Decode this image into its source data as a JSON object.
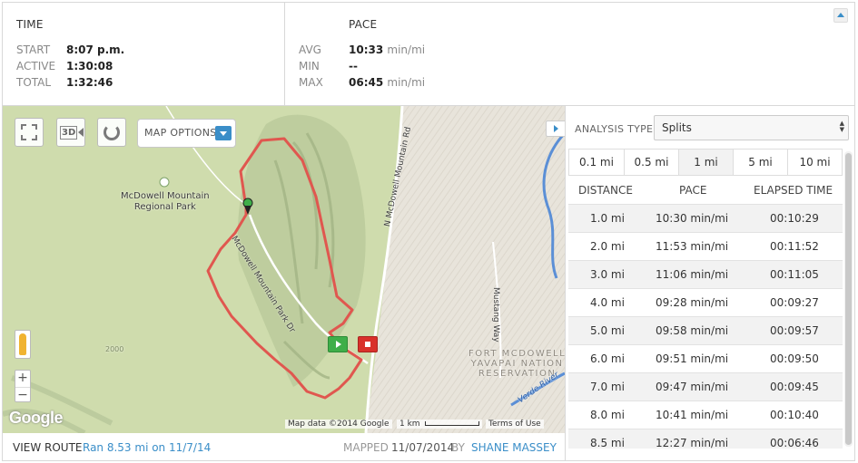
{
  "summary": {
    "time": {
      "title": "TIME",
      "rows": [
        {
          "label": "START",
          "value": "8:07 p.m.",
          "unit": ""
        },
        {
          "label": "ACTIVE",
          "value": "1:30:08",
          "unit": ""
        },
        {
          "label": "TOTAL",
          "value": "1:32:46",
          "unit": ""
        }
      ]
    },
    "pace": {
      "title": "PACE",
      "rows": [
        {
          "label": "AVG",
          "value": "10:33",
          "unit": "min/mi"
        },
        {
          "label": "MIN",
          "value": "--",
          "unit": ""
        },
        {
          "label": "MAX",
          "value": "06:45",
          "unit": "min/mi"
        }
      ]
    }
  },
  "map": {
    "options_label": "MAP OPTIONS",
    "btn_3d": "3D",
    "zoom_in": "+",
    "zoom_out": "−",
    "labels": {
      "park": "McDowell Mountain\nRegional Park",
      "park_dr": "McDowell Mountain Park Dr",
      "n_mcdowell": "N McDowell Mountain Rd",
      "mustang": "Mustang Way",
      "fort_mcdowell": "FORT MCDOWELL\nYAVAPAI NATION\nRESERVATION",
      "verde": "Verde River",
      "contour_2000": "2000"
    },
    "attribution": "Map data ©2014 Google",
    "scale": "1 km",
    "terms": "Terms of Use",
    "google": "Google"
  },
  "footer": {
    "view_route": "VIEW ROUTE",
    "ran": "Ran 8.53 mi on 11/7/14",
    "mapped_label": "MAPPED",
    "mapped_date": "11/07/2014",
    "by": "BY",
    "owner": "SHANE MASSEY"
  },
  "analysis": {
    "type_label": "ANALYSIS TYPE:",
    "type_value": "Splits",
    "tabs": [
      "0.1 mi",
      "0.5 mi",
      "1 mi",
      "5 mi",
      "10 mi"
    ],
    "active_tab": "1 mi",
    "headers": [
      "DISTANCE",
      "PACE",
      "ELAPSED TIME"
    ],
    "rows": [
      {
        "distance": "1.0 mi",
        "pace": "10:30 min/mi",
        "elapsed": "00:10:29"
      },
      {
        "distance": "2.0 mi",
        "pace": "11:53 min/mi",
        "elapsed": "00:11:52"
      },
      {
        "distance": "3.0 mi",
        "pace": "11:06 min/mi",
        "elapsed": "00:11:05"
      },
      {
        "distance": "4.0 mi",
        "pace": "09:28 min/mi",
        "elapsed": "00:09:27"
      },
      {
        "distance": "5.0 mi",
        "pace": "09:58 min/mi",
        "elapsed": "00:09:57"
      },
      {
        "distance": "6.0 mi",
        "pace": "09:51 min/mi",
        "elapsed": "00:09:50"
      },
      {
        "distance": "7.0 mi",
        "pace": "09:47 min/mi",
        "elapsed": "00:09:45"
      },
      {
        "distance": "8.0 mi",
        "pace": "10:41 min/mi",
        "elapsed": "00:10:40"
      },
      {
        "distance": "8.5 mi",
        "pace": "12:27 min/mi",
        "elapsed": "00:06:46"
      }
    ]
  },
  "colors": {
    "accent": "#3a8ec8",
    "route": "#e0574f",
    "start_marker": "#3fae49",
    "end_marker": "#d9312a"
  }
}
